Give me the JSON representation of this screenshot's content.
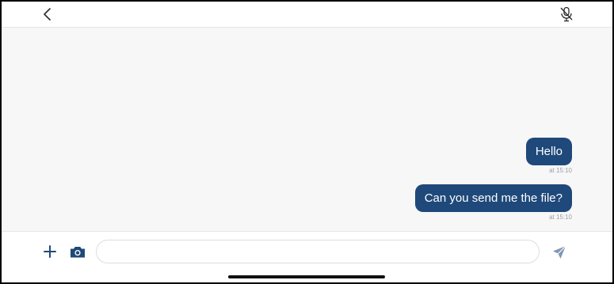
{
  "header": {
    "back_icon": "chevron-left-icon",
    "mic_icon": "microphone-off-icon"
  },
  "messages": [
    {
      "text": "Hello",
      "time": "at 15:10"
    },
    {
      "text": "Can you send me the file?",
      "time": "at 15:10"
    }
  ],
  "composer": {
    "input_value": "",
    "input_placeholder": "",
    "add_icon": "plus-icon",
    "camera_icon": "camera-icon",
    "send_icon": "send-icon"
  },
  "colors": {
    "bubble": "#1f497a",
    "accent": "#1f497a",
    "send_icon": "#7f97b4",
    "background": "#f7f7f8"
  }
}
